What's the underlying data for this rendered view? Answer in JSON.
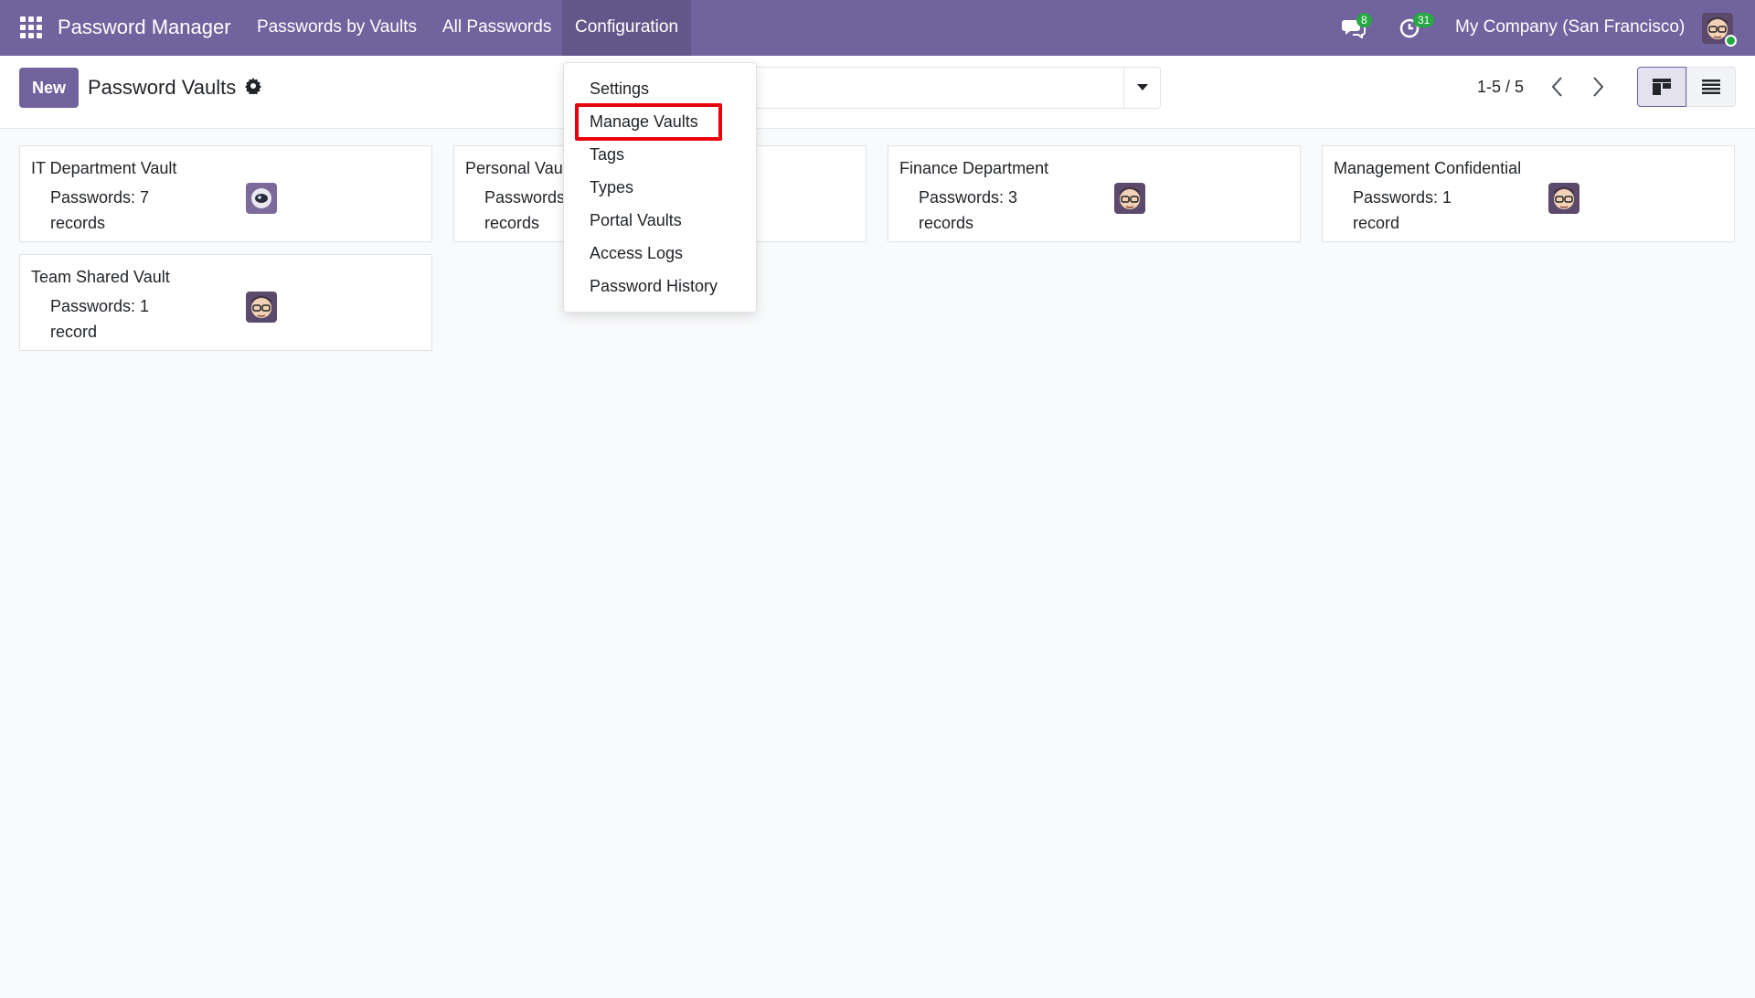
{
  "navbar": {
    "brand": "Password Manager",
    "menu": [
      "Passwords by Vaults",
      "All Passwords",
      "Configuration"
    ],
    "messages_count": "8",
    "activities_count": "31",
    "company": "My Company (San Francisco)",
    "background_color": "#71639e"
  },
  "control_panel": {
    "new_label": "New",
    "title": "Password Vaults",
    "pager_value": "1-5 / 5"
  },
  "cards": [
    {
      "title": "IT Department Vault",
      "count_label": "Passwords: 7 records",
      "avatar": "robot-avatar"
    },
    {
      "title": "Personal Vault",
      "count_label": "Passwords records",
      "avatar": "user-avatar"
    },
    {
      "title": "Finance Department",
      "count_label": "Passwords: 3 records",
      "avatar": "user-avatar"
    },
    {
      "title": "Management Confidential",
      "count_label": "Passwords: 1 record",
      "avatar": "user-avatar"
    },
    {
      "title": "Team Shared Vault",
      "count_label": "Passwords: 1 record",
      "avatar": "user-avatar"
    }
  ],
  "dropdown": {
    "items": [
      "Settings",
      "Manage Vaults",
      "Tags",
      "Types",
      "Portal Vaults",
      "Access Logs",
      "Password History"
    ],
    "highlighted": "Manage Vaults",
    "highlight_color": "#e8000b"
  }
}
